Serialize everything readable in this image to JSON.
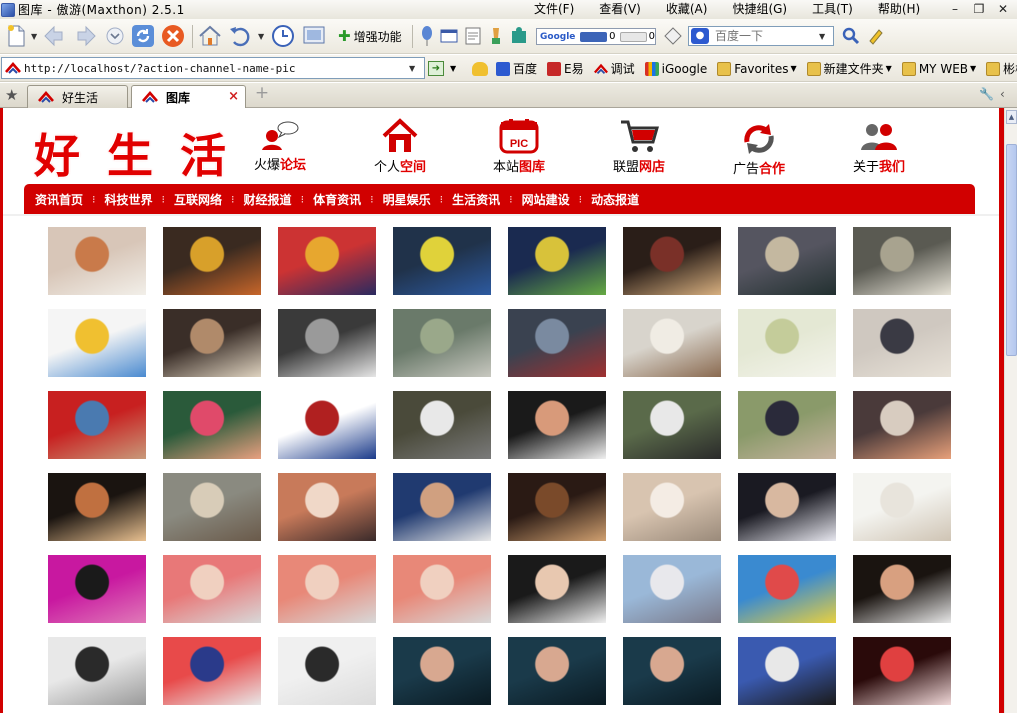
{
  "window": {
    "title": "图库 - 傲游(Maxthon) 2.5.1",
    "menus": [
      "文件(F)",
      "查看(V)",
      "收藏(A)",
      "快捷组(G)",
      "工具(T)",
      "帮助(H)"
    ],
    "controls": {
      "minimize": "–",
      "restore": "❐",
      "close": "✕"
    }
  },
  "toolbar": {
    "enhance_label": "增强功能",
    "google_label": "Google",
    "google_counter_a": "0",
    "google_counter_b": "0",
    "search_placeholder": "百度一下"
  },
  "address": {
    "url": "http://localhost/?action-channel-name-pic"
  },
  "links": [
    {
      "label": "百度",
      "color": "#2d5ad0",
      "dropdown": false
    },
    {
      "label": "E易",
      "color": "#c62828",
      "dropdown": false
    },
    {
      "label": "调试",
      "color": "#d10000",
      "dropdown": false
    },
    {
      "label": "iGoogle",
      "color": "#3aa757",
      "dropdown": false
    },
    {
      "label": "Favorites",
      "color": "#e8c14a",
      "dropdown": true
    },
    {
      "label": "新建文件夹",
      "color": "#e8c14a",
      "dropdown": true
    },
    {
      "label": "MY WEB",
      "color": "#e8c14a",
      "dropdown": true
    },
    {
      "label": "彬彬",
      "color": "#e8c14a",
      "dropdown": false
    }
  ],
  "tabs": [
    {
      "label": "好生活",
      "active": false
    },
    {
      "label": "图库",
      "active": true
    }
  ],
  "site": {
    "logo_chars": [
      "好",
      "生",
      "活"
    ],
    "nav": [
      {
        "pre": "火爆",
        "hi": "论坛",
        "icon": "forum-icon"
      },
      {
        "pre": "个人",
        "hi": "空间",
        "icon": "home-icon"
      },
      {
        "pre": "本站",
        "hi": "图库",
        "icon": "pic-icon",
        "badge": "PIC"
      },
      {
        "pre": "联盟",
        "hi": "网店",
        "icon": "cart-icon"
      },
      {
        "pre": "广告",
        "hi": "合作",
        "icon": "refresh-icon"
      },
      {
        "pre": "关于",
        "hi": "我们",
        "icon": "people-icon"
      }
    ],
    "menu": [
      "资讯首页",
      "科技世界",
      "互联网络",
      "财经报道",
      "体育资讯",
      "明星娱乐",
      "生活资讯",
      "网站建设",
      "动态报道"
    ]
  },
  "gallery": {
    "photos": [
      {
        "a": "#d8c6b8",
        "b": "#c97a4a",
        "c": "#f2efe9"
      },
      {
        "a": "#3a2a20",
        "b": "#d8a02a",
        "c": "#c8662a"
      },
      {
        "a": "#cc3333",
        "b": "#e7a72f",
        "c": "#2a2a60"
      },
      {
        "a": "#20324a",
        "b": "#e0d23a",
        "c": "#2d5aa0"
      },
      {
        "a": "#1a2a50",
        "b": "#d8c23a",
        "c": "#66aa44"
      },
      {
        "a": "#2a1e18",
        "b": "#7a3028",
        "c": "#d8b080"
      },
      {
        "a": "#555560",
        "b": "#c4b8a0",
        "c": "#223030"
      },
      {
        "a": "#5a5a52",
        "b": "#a8a38f",
        "c": "#e8e4d8"
      },
      {
        "a": "#f5f5f5",
        "b": "#f0c030",
        "c": "#4a8ad0"
      },
      {
        "a": "#3a2e28",
        "b": "#b08a6a",
        "c": "#dfd3c0"
      },
      {
        "a": "#3a3a3a",
        "b": "#9a9a9a",
        "c": "#e6e6e6"
      },
      {
        "a": "#6a7a6a",
        "b": "#9aa88a",
        "c": "#c8c8c0"
      },
      {
        "a": "#3a4250",
        "b": "#7a8aa0",
        "c": "#a03030"
      },
      {
        "a": "#d8d4cc",
        "b": "#f0ece4",
        "c": "#8a6a50"
      },
      {
        "a": "#e4e8d4",
        "b": "#c4cc9a",
        "c": "#f4f4ec"
      },
      {
        "a": "#cfc8c0",
        "b": "#3a3a44",
        "c": "#e8e2d8"
      },
      {
        "a": "#c82020",
        "b": "#4a7ab0",
        "c": "#c89a7a"
      },
      {
        "a": "#2a5a3a",
        "b": "#e04a6a",
        "c": "#e8a080"
      },
      {
        "a": "#ffffff",
        "b": "#b02020",
        "c": "#1a3a8a"
      },
      {
        "a": "#4a4a3a",
        "b": "#e8e8e8",
        "c": "#7a7a7a"
      },
      {
        "a": "#1a1a1a",
        "b": "#d89a7a",
        "c": "#f0f0f0"
      },
      {
        "a": "#5a6a4a",
        "b": "#e8e8e8",
        "c": "#2a2a2a"
      },
      {
        "a": "#8a9a6a",
        "b": "#2a2a3a",
        "c": "#c8b4a0"
      },
      {
        "a": "#4a3a3a",
        "b": "#d8ccc0",
        "c": "#e8a07a"
      },
      {
        "a": "#1a1410",
        "b": "#c07040",
        "c": "#e8c090"
      },
      {
        "a": "#8a8a80",
        "b": "#d8ccb8",
        "c": "#6a5a4a"
      },
      {
        "a": "#c87a5a",
        "b": "#f0d8c8",
        "c": "#3a2a2a"
      },
      {
        "a": "#203a70",
        "b": "#d0a080",
        "c": "#e8e8e8"
      },
      {
        "a": "#2a1a14",
        "b": "#7a4a2a",
        "c": "#d0a070"
      },
      {
        "a": "#d8c4b0",
        "b": "#f4ece4",
        "c": "#9a8a7a"
      },
      {
        "a": "#1a1a22",
        "b": "#d8b8a0",
        "c": "#e8e8f0"
      },
      {
        "a": "#f4f4f0",
        "b": "#e8e4dc",
        "c": "#cfc4b4"
      },
      {
        "a": "#c818a0",
        "b": "#1a1a1a",
        "c": "#e07ab8"
      },
      {
        "a": "#e87878",
        "b": "#f0d0c0",
        "c": "#d8d8d8"
      },
      {
        "a": "#e88878",
        "b": "#f0d0c0",
        "c": "#d8d8d8"
      },
      {
        "a": "#e88878",
        "b": "#f0d0c0",
        "c": "#d8d8d8"
      },
      {
        "a": "#1a1a1a",
        "b": "#e8c8b0",
        "c": "#f0f0f0"
      },
      {
        "a": "#9ab8d8",
        "b": "#e8e8ec",
        "c": "#7a7a8a"
      },
      {
        "a": "#3a8ad0",
        "b": "#e04a4a",
        "c": "#e8d040"
      },
      {
        "a": "#1a1410",
        "b": "#d8a080",
        "c": "#e8e8e8"
      },
      {
        "a": "#e8e8e8",
        "b": "#2a2a2a",
        "c": "#9a9a9a"
      },
      {
        "a": "#e84a4a",
        "b": "#2a3a8a",
        "c": "#e8e8e8"
      },
      {
        "a": "#f0f0f0",
        "b": "#2a2a2a",
        "c": "#dcdcdc"
      },
      {
        "a": "#1a3a4a",
        "b": "#d8a890",
        "c": "#0a1a22"
      },
      {
        "a": "#1a3a4a",
        "b": "#d8a890",
        "c": "#0a1a22"
      },
      {
        "a": "#1a3a4a",
        "b": "#d8a890",
        "c": "#0a1a22"
      },
      {
        "a": "#3a5ab0",
        "b": "#e8e8e8",
        "c": "#1a1a1a"
      },
      {
        "a": "#2a0a0a",
        "b": "#e04040",
        "c": "#f0d8d8"
      }
    ]
  }
}
